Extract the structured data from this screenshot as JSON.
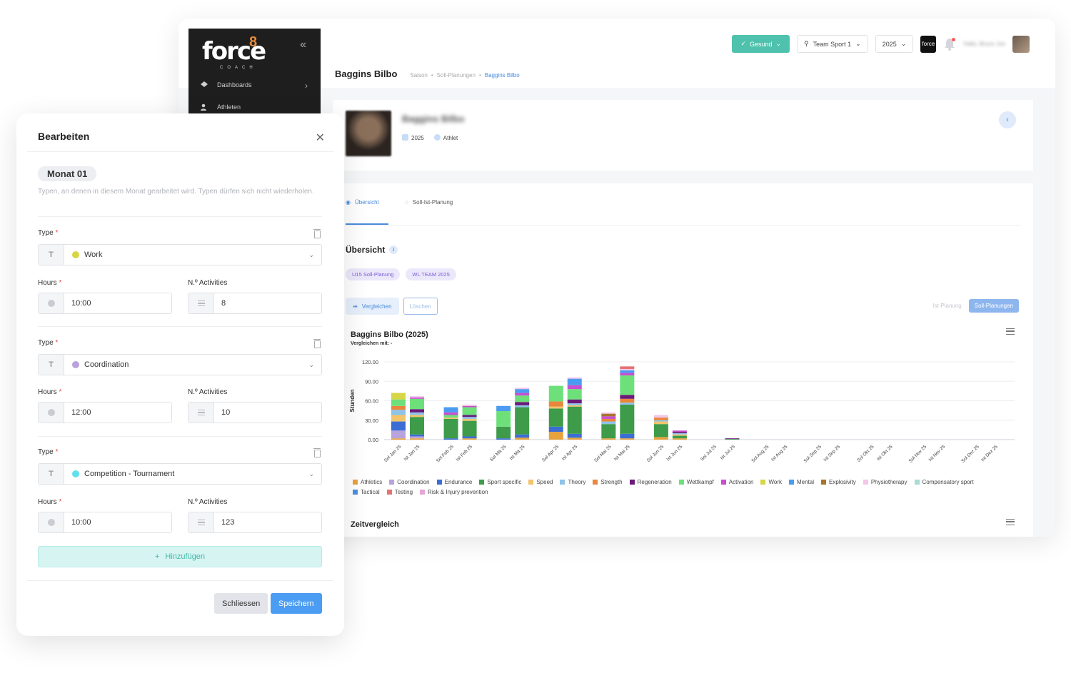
{
  "sidebar": {
    "brand": "force",
    "brand_sup": "8",
    "brand_sub": "COACH",
    "items": [
      {
        "label": "Dashboards",
        "icon": "diamond-icon"
      },
      {
        "label": "Athleten",
        "icon": "users-icon"
      }
    ]
  },
  "topbar": {
    "status_label": "Gesund",
    "team_label": "Team Sport 1",
    "year_label": "2025",
    "brand_mini": "force",
    "user_name": "Hallo, Bruce Jon"
  },
  "page": {
    "title": "Baggins Bilbo",
    "breadcrumb": [
      "Saison",
      "Soll-Planungen",
      "Baggins Bilbo"
    ]
  },
  "profile": {
    "name": "Baggins Bilbo",
    "year": "2025",
    "role": "Athlet"
  },
  "tabs": [
    {
      "label": "Übersicht",
      "icon": "eye-icon",
      "active": true
    },
    {
      "label": "Soll-Ist-Planung",
      "icon": "loader-icon",
      "active": false
    }
  ],
  "overview": {
    "title": "Übersicht",
    "info": "i",
    "chips": [
      "U15 Soll-Planung",
      "WL TEAM 2025"
    ],
    "compare_label": "Vergleichen",
    "delete_label": "Löschen",
    "toggle_off": "Ist-Planung",
    "toggle_on": "Soll-Planungen",
    "chart_title": "Baggins Bilbo (2025)",
    "chart_subtitle": "Vergleichen mit: -",
    "time_title": "Zeitvergleich"
  },
  "chart_data": {
    "type": "bar",
    "stacked": true,
    "ylabel": "Stunden",
    "ylim": [
      0,
      120
    ],
    "yticks": [
      "120.00",
      "90.00",
      "60.00",
      "30.00",
      "0.00"
    ],
    "categories": [
      "Sol Jan 25",
      "Ist Jan 25",
      "Sol Feb 25",
      "Ist Feb 25",
      "Sol Mä 25",
      "Ist Mä 25",
      "Sol Apr 25",
      "Ist Apr 25",
      "Sol Mai 25",
      "Ist Mai 25",
      "Sol Jun 25",
      "Ist Jun 25",
      "Sol Jul 25",
      "Ist Jul 25",
      "Sol Aug 25",
      "Ist Aug 25",
      "Sol Sep 25",
      "Ist Sep 25",
      "Sol Okt 25",
      "Ist Okt 25",
      "Sol Nov 25",
      "Ist Nov 25",
      "Sol Dez 25",
      "Ist Dez 25"
    ],
    "series": [
      {
        "name": "Athletics",
        "color": "#e8a23c",
        "values": [
          2,
          2,
          0,
          2,
          0,
          3,
          12,
          3,
          2,
          2,
          4,
          2,
          0,
          0,
          0,
          0,
          0,
          0,
          0,
          0,
          0,
          0,
          0,
          0
        ]
      },
      {
        "name": "Coordination",
        "color": "#b9a3dc",
        "values": [
          12,
          3,
          0,
          0,
          0,
          0,
          0,
          0,
          0,
          0,
          0,
          0,
          0,
          0,
          0,
          0,
          0,
          0,
          0,
          0,
          0,
          0,
          0,
          0
        ]
      },
      {
        "name": "Endurance",
        "color": "#3b6dd4",
        "values": [
          14,
          3,
          2,
          3,
          2,
          5,
          8,
          6,
          0,
          7,
          0,
          0,
          0,
          0,
          0,
          0,
          0,
          0,
          0,
          0,
          0,
          0,
          0,
          0
        ]
      },
      {
        "name": "Sport specific",
        "color": "#3e9b4a",
        "values": [
          0,
          27,
          30,
          24,
          18,
          42,
          28,
          42,
          22,
          45,
          20,
          4,
          0,
          1,
          0,
          0,
          0,
          0,
          0,
          0,
          0,
          0,
          0,
          0
        ]
      },
      {
        "name": "Speed",
        "color": "#f2c46b",
        "values": [
          10,
          3,
          2,
          3,
          0,
          0,
          3,
          2,
          0,
          0,
          4,
          2,
          0,
          0,
          0,
          0,
          0,
          0,
          0,
          0,
          0,
          0,
          0,
          0
        ]
      },
      {
        "name": "Theory",
        "color": "#8ec3ea",
        "values": [
          8,
          4,
          0,
          3,
          0,
          3,
          0,
          3,
          4,
          3,
          2,
          2,
          0,
          0,
          0,
          0,
          0,
          0,
          0,
          0,
          0,
          0,
          0,
          0
        ]
      },
      {
        "name": "Strength",
        "color": "#e8873c",
        "values": [
          6,
          0,
          0,
          0,
          0,
          0,
          8,
          0,
          4,
          6,
          4,
          0,
          0,
          0,
          0,
          0,
          0,
          0,
          0,
          0,
          0,
          0,
          0,
          0
        ]
      },
      {
        "name": "Regeneration",
        "color": "#6b1a7a",
        "values": [
          0,
          5,
          0,
          3,
          0,
          5,
          0,
          6,
          0,
          6,
          0,
          2,
          0,
          1,
          0,
          0,
          0,
          0,
          0,
          0,
          0,
          0,
          0,
          0
        ]
      },
      {
        "name": "Wettkampf",
        "color": "#6de07a",
        "values": [
          10,
          16,
          4,
          12,
          24,
          10,
          24,
          16,
          0,
          30,
          0,
          0,
          0,
          0,
          0,
          0,
          0,
          0,
          0,
          0,
          0,
          0,
          0,
          0
        ]
      },
      {
        "name": "Activation",
        "color": "#c74fd0",
        "values": [
          0,
          2,
          4,
          2,
          0,
          4,
          0,
          6,
          4,
          4,
          0,
          2,
          0,
          0,
          0,
          0,
          0,
          0,
          0,
          0,
          0,
          0,
          0,
          0
        ]
      },
      {
        "name": "Work",
        "color": "#d6d646",
        "values": [
          10,
          0,
          0,
          0,
          0,
          0,
          0,
          0,
          0,
          0,
          0,
          0,
          0,
          0,
          0,
          0,
          0,
          0,
          0,
          0,
          0,
          0,
          0,
          0
        ]
      },
      {
        "name": "Mental",
        "color": "#4b9cf0",
        "values": [
          0,
          0,
          8,
          0,
          8,
          6,
          0,
          10,
          0,
          4,
          0,
          0,
          0,
          0,
          0,
          0,
          0,
          0,
          0,
          0,
          0,
          0,
          0,
          0
        ]
      },
      {
        "name": "Explosivity",
        "color": "#a8742c",
        "values": [
          0,
          0,
          0,
          0,
          0,
          0,
          0,
          0,
          4,
          0,
          0,
          0,
          0,
          0,
          0,
          0,
          0,
          0,
          0,
          0,
          0,
          0,
          0,
          0
        ]
      },
      {
        "name": "Physiotherapy",
        "color": "#f3c6ea",
        "values": [
          0,
          2,
          0,
          2,
          0,
          2,
          0,
          2,
          2,
          2,
          4,
          0,
          0,
          0,
          0,
          0,
          0,
          0,
          0,
          0,
          0,
          0,
          0,
          0
        ]
      },
      {
        "name": "Compensatory sport",
        "color": "#a9dcd6",
        "values": [
          0,
          0,
          0,
          0,
          0,
          0,
          0,
          0,
          0,
          0,
          0,
          0,
          0,
          0,
          0,
          0,
          0,
          0,
          0,
          0,
          0,
          0,
          0,
          0
        ]
      },
      {
        "name": "Tactical",
        "color": "#4b8fe0",
        "values": [
          0,
          0,
          0,
          0,
          0,
          0,
          0,
          0,
          0,
          0,
          0,
          0,
          0,
          0,
          0,
          0,
          0,
          0,
          0,
          0,
          0,
          0,
          0,
          0
        ]
      },
      {
        "name": "Testing",
        "color": "#e57373",
        "values": [
          0,
          0,
          0,
          0,
          0,
          0,
          0,
          0,
          0,
          4,
          0,
          0,
          0,
          0,
          0,
          0,
          0,
          0,
          0,
          0,
          0,
          0,
          0,
          0
        ]
      },
      {
        "name": "Risk & Injury prevention",
        "color": "#e7a6d3",
        "values": [
          0,
          0,
          0,
          0,
          0,
          0,
          0,
          0,
          0,
          0,
          0,
          0,
          0,
          0,
          0,
          0,
          0,
          0,
          0,
          0,
          0,
          0,
          0,
          0
        ]
      }
    ],
    "grid": true,
    "legend_position": "bottom"
  },
  "modal": {
    "title": "Bearbeiten",
    "close": "✕",
    "month": "Monat 01",
    "description": "Typen, an denen in diesem Monat gearbeitet wird. Typen dürfen sich nicht wiederholen.",
    "type_label": "Type",
    "hours_label": "Hours",
    "activities_label": "N.º Activities",
    "required_mark": "*",
    "type_prefix": "T",
    "entries": [
      {
        "type": "Work",
        "color": "#d6d646",
        "hours": "10:00",
        "activities": "8"
      },
      {
        "type": "Coordination",
        "color": "#b9a3dc",
        "hours": "12:00",
        "activities": "10"
      },
      {
        "type": "Competition - Tournament",
        "color": "#5ee0ee",
        "hours": "10:00",
        "activities": "123"
      }
    ],
    "add_label": "Hinzufügen",
    "close_label": "Schliessen",
    "save_label": "Speichern"
  }
}
